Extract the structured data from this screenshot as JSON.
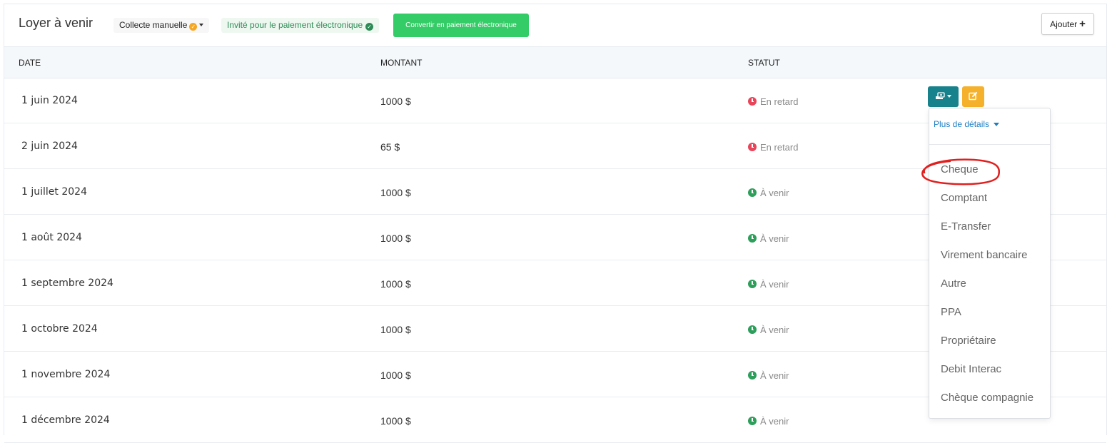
{
  "header": {
    "title": "Loyer à venir",
    "collect_label": "Collecte manuelle",
    "invited_label": "Invité pour le paiement électronique",
    "convert_label": "Convertir en paiement électronique",
    "add_label": "Ajouter"
  },
  "table": {
    "columns": [
      "DATE",
      "MONTANT",
      "STATUT"
    ],
    "rows": [
      {
        "date": "1 juin 2024",
        "amount": "1000 $",
        "status": "En retard",
        "state": "late"
      },
      {
        "date": "2 juin 2024",
        "amount": "65 $",
        "status": "En retard",
        "state": "late"
      },
      {
        "date": "1 juillet 2024",
        "amount": "1000 $",
        "status": "À venir",
        "state": "upcoming"
      },
      {
        "date": "1 août 2024",
        "amount": "1000 $",
        "status": "À venir",
        "state": "upcoming"
      },
      {
        "date": "1 septembre 2024",
        "amount": "1000 $",
        "status": "À venir",
        "state": "upcoming"
      },
      {
        "date": "1 octobre 2024",
        "amount": "1000 $",
        "status": "À venir",
        "state": "upcoming"
      },
      {
        "date": "1 novembre 2024",
        "amount": "1000 $",
        "status": "À venir",
        "state": "upcoming"
      },
      {
        "date": "1 décembre 2024",
        "amount": "1000 $",
        "status": "À venir",
        "state": "upcoming"
      }
    ]
  },
  "dropdown": {
    "more_details": "Plus de détails",
    "items": [
      "Cheque",
      "Comptant",
      "E-Transfer",
      "Virement bancaire",
      "Autre",
      "PPA",
      "Propriétaire",
      "Debit Interac",
      "Chèque compagnie"
    ]
  },
  "colors": {
    "late": "#e8455a",
    "upcoming": "#2e9e5b",
    "convert_button": "#33cc66",
    "pay_button": "#17828b",
    "edit_button": "#f5b12b",
    "link": "#1f7fc4",
    "annotation": "#e0201f"
  },
  "icons": {
    "collect_status": "check-circle-icon",
    "invited_status": "check-circle-icon",
    "pay": "money-hand-icon",
    "edit": "edit-icon",
    "add": "plus-icon",
    "late_status": "clock-icon",
    "upcoming_status": "clock-icon"
  }
}
